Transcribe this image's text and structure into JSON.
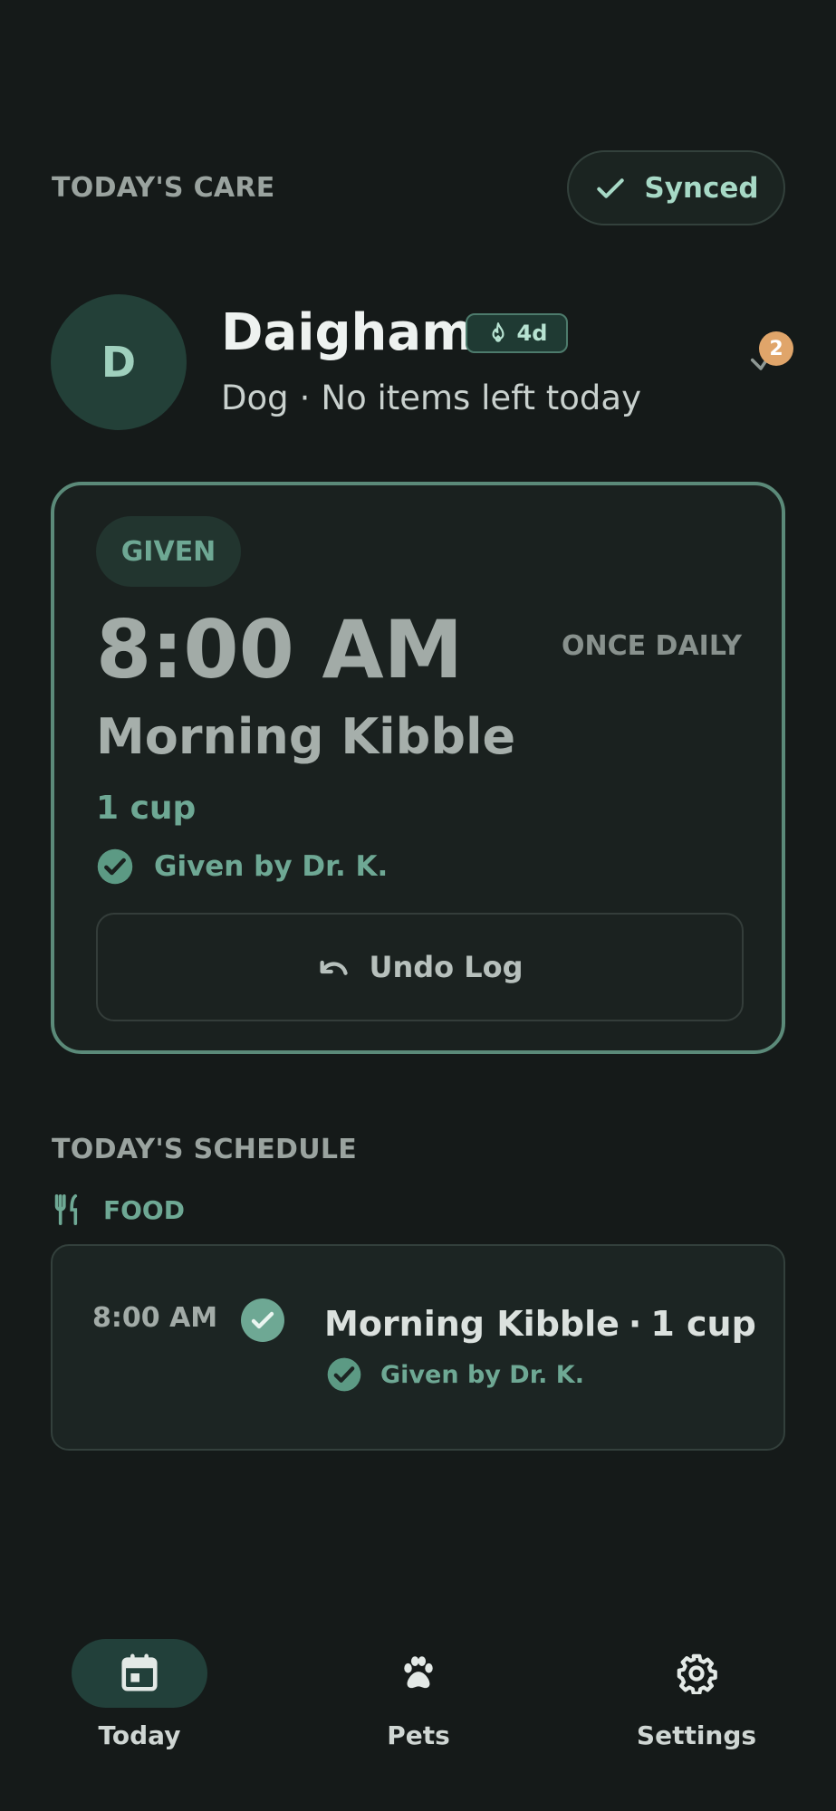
{
  "header": {
    "section_title": "TODAY'S CARE",
    "sync_status": "Synced",
    "sync_icon": "check-icon"
  },
  "pet": {
    "avatar_initial": "D",
    "name": "Daigham",
    "streak": "4d",
    "streak_icon": "flame-icon",
    "species": "Dog",
    "separator": "·",
    "status": "No items left today",
    "alert_count": "2"
  },
  "current_item": {
    "status_chip": "GIVEN",
    "time": "8:00 AM",
    "frequency": "ONCE DAILY",
    "title": "Morning Kibble",
    "amount": "1 cup",
    "given_by": "Given by Dr. K.",
    "undo_label": "Undo Log"
  },
  "schedule": {
    "section_title": "TODAY'S SCHEDULE",
    "category": "FOOD",
    "category_icon": "utensils-icon",
    "items": [
      {
        "time": "8:00 AM",
        "title": "Morning Kibble",
        "separator": "·",
        "amount": "1 cup",
        "given_by": "Given by Dr. K."
      }
    ]
  },
  "nav": {
    "items": [
      {
        "label": "Today",
        "icon": "calendar-icon",
        "active": true
      },
      {
        "label": "Pets",
        "icon": "paw-icon",
        "active": false
      },
      {
        "label": "Settings",
        "icon": "gear-icon",
        "active": false
      }
    ]
  },
  "colors": {
    "background": "#151a19",
    "accent": "#6ea894",
    "card_border": "#5b8a79",
    "badge_orange": "#e0a56a"
  }
}
